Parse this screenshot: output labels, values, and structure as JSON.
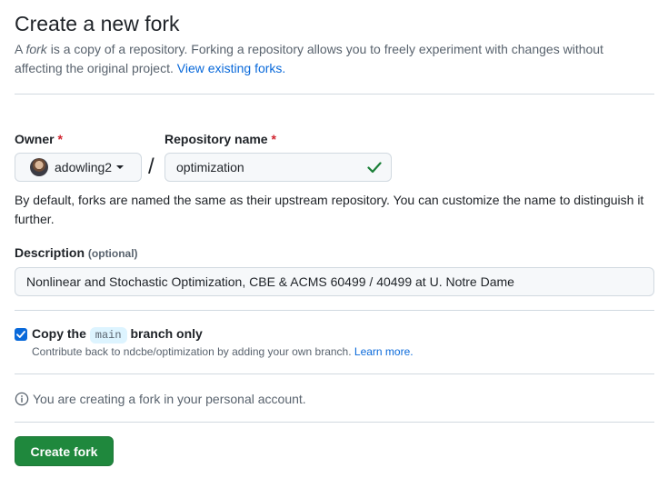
{
  "page": {
    "title": "Create a new fork",
    "intro_prefix": "A ",
    "intro_em": "fork",
    "intro_text": " is a copy of a repository. Forking a repository allows you to freely experiment with changes without affecting the original project. ",
    "intro_link": "View existing forks."
  },
  "owner": {
    "label": "Owner",
    "required_mark": "*",
    "value": "adowling2"
  },
  "separator": "/",
  "repo_name": {
    "label": "Repository name",
    "required_mark": "*",
    "value": "optimization",
    "valid_color": "#1a7f37"
  },
  "name_help": "By default, forks are named the same as their upstream repository. You can customize the name to distinguish it further.",
  "description": {
    "label": "Description",
    "optional": "(optional)",
    "value": "Nonlinear and Stochastic Optimization, CBE & ACMS 60499 / 40499 at U. Notre Dame"
  },
  "copy_branch": {
    "checked": true,
    "label_prefix": "Copy the",
    "branch": "main",
    "label_suffix": "branch only",
    "help_text": "Contribute back to ndcbe/optimization by adding your own branch.",
    "help_link": "Learn more."
  },
  "notice": {
    "icon": "info-icon",
    "text": "You are creating a fork in your personal account."
  },
  "submit_label": "Create fork",
  "colors": {
    "accent": "#0969da",
    "primary_button": "#1f883d",
    "required": "#d1242f"
  }
}
